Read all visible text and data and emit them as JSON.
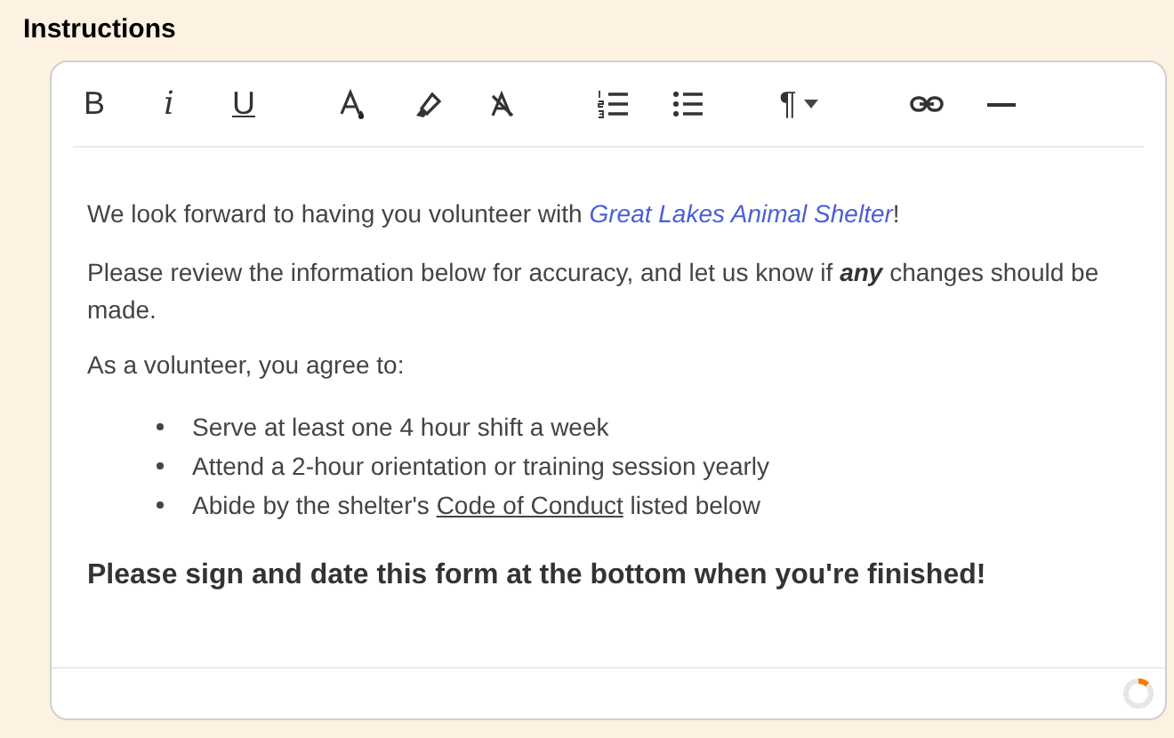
{
  "section_title": "Instructions",
  "toolbar": [
    {
      "kind": "bold",
      "text": "B"
    },
    {
      "kind": "italic",
      "text": "i"
    },
    {
      "kind": "underline",
      "text": "U"
    },
    {
      "kind": "text-color"
    },
    {
      "kind": "highlight"
    },
    {
      "kind": "clear-format"
    },
    {
      "kind": "ordered-list"
    },
    {
      "kind": "bullet-list"
    },
    {
      "kind": "paragraph",
      "text": "¶"
    },
    {
      "kind": "link"
    },
    {
      "kind": "rule"
    }
  ],
  "content": {
    "intro": {
      "before": "We look forward to having you volunteer with ",
      "link": "Great Lakes Animal Shelter",
      "after": "!"
    },
    "review": "Please review the information below for accuracy, and let us know if **any** changes should be made.",
    "lead": "As a volunteer, you agree to:",
    "bullets": [
      {
        "before": "Serve at least one 4 hour shift a week"
      },
      {
        "before": "Attend a 2-hour orientation or training session yearly"
      },
      {
        "before": "Abide by the shelter's ",
        "link": "Code of Conduct",
        "after": " listed below"
      }
    ],
    "closing": "Please sign and date this form at the bottom when you're finished!"
  }
}
